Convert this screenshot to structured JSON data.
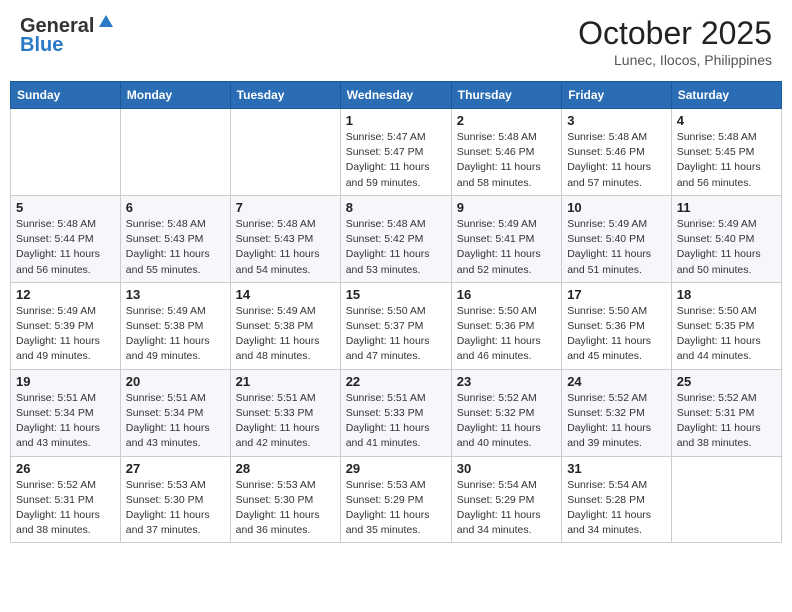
{
  "header": {
    "logo_general": "General",
    "logo_blue": "Blue",
    "month_title": "October 2025",
    "location": "Lunec, Ilocos, Philippines"
  },
  "days_of_week": [
    "Sunday",
    "Monday",
    "Tuesday",
    "Wednesday",
    "Thursday",
    "Friday",
    "Saturday"
  ],
  "weeks": [
    {
      "cells": [
        {
          "day": "",
          "content": ""
        },
        {
          "day": "",
          "content": ""
        },
        {
          "day": "",
          "content": ""
        },
        {
          "day": "1",
          "content": "Sunrise: 5:47 AM\nSunset: 5:47 PM\nDaylight: 11 hours\nand 59 minutes."
        },
        {
          "day": "2",
          "content": "Sunrise: 5:48 AM\nSunset: 5:46 PM\nDaylight: 11 hours\nand 58 minutes."
        },
        {
          "day": "3",
          "content": "Sunrise: 5:48 AM\nSunset: 5:46 PM\nDaylight: 11 hours\nand 57 minutes."
        },
        {
          "day": "4",
          "content": "Sunrise: 5:48 AM\nSunset: 5:45 PM\nDaylight: 11 hours\nand 56 minutes."
        }
      ]
    },
    {
      "cells": [
        {
          "day": "5",
          "content": "Sunrise: 5:48 AM\nSunset: 5:44 PM\nDaylight: 11 hours\nand 56 minutes."
        },
        {
          "day": "6",
          "content": "Sunrise: 5:48 AM\nSunset: 5:43 PM\nDaylight: 11 hours\nand 55 minutes."
        },
        {
          "day": "7",
          "content": "Sunrise: 5:48 AM\nSunset: 5:43 PM\nDaylight: 11 hours\nand 54 minutes."
        },
        {
          "day": "8",
          "content": "Sunrise: 5:48 AM\nSunset: 5:42 PM\nDaylight: 11 hours\nand 53 minutes."
        },
        {
          "day": "9",
          "content": "Sunrise: 5:49 AM\nSunset: 5:41 PM\nDaylight: 11 hours\nand 52 minutes."
        },
        {
          "day": "10",
          "content": "Sunrise: 5:49 AM\nSunset: 5:40 PM\nDaylight: 11 hours\nand 51 minutes."
        },
        {
          "day": "11",
          "content": "Sunrise: 5:49 AM\nSunset: 5:40 PM\nDaylight: 11 hours\nand 50 minutes."
        }
      ]
    },
    {
      "cells": [
        {
          "day": "12",
          "content": "Sunrise: 5:49 AM\nSunset: 5:39 PM\nDaylight: 11 hours\nand 49 minutes."
        },
        {
          "day": "13",
          "content": "Sunrise: 5:49 AM\nSunset: 5:38 PM\nDaylight: 11 hours\nand 49 minutes."
        },
        {
          "day": "14",
          "content": "Sunrise: 5:49 AM\nSunset: 5:38 PM\nDaylight: 11 hours\nand 48 minutes."
        },
        {
          "day": "15",
          "content": "Sunrise: 5:50 AM\nSunset: 5:37 PM\nDaylight: 11 hours\nand 47 minutes."
        },
        {
          "day": "16",
          "content": "Sunrise: 5:50 AM\nSunset: 5:36 PM\nDaylight: 11 hours\nand 46 minutes."
        },
        {
          "day": "17",
          "content": "Sunrise: 5:50 AM\nSunset: 5:36 PM\nDaylight: 11 hours\nand 45 minutes."
        },
        {
          "day": "18",
          "content": "Sunrise: 5:50 AM\nSunset: 5:35 PM\nDaylight: 11 hours\nand 44 minutes."
        }
      ]
    },
    {
      "cells": [
        {
          "day": "19",
          "content": "Sunrise: 5:51 AM\nSunset: 5:34 PM\nDaylight: 11 hours\nand 43 minutes."
        },
        {
          "day": "20",
          "content": "Sunrise: 5:51 AM\nSunset: 5:34 PM\nDaylight: 11 hours\nand 43 minutes."
        },
        {
          "day": "21",
          "content": "Sunrise: 5:51 AM\nSunset: 5:33 PM\nDaylight: 11 hours\nand 42 minutes."
        },
        {
          "day": "22",
          "content": "Sunrise: 5:51 AM\nSunset: 5:33 PM\nDaylight: 11 hours\nand 41 minutes."
        },
        {
          "day": "23",
          "content": "Sunrise: 5:52 AM\nSunset: 5:32 PM\nDaylight: 11 hours\nand 40 minutes."
        },
        {
          "day": "24",
          "content": "Sunrise: 5:52 AM\nSunset: 5:32 PM\nDaylight: 11 hours\nand 39 minutes."
        },
        {
          "day": "25",
          "content": "Sunrise: 5:52 AM\nSunset: 5:31 PM\nDaylight: 11 hours\nand 38 minutes."
        }
      ]
    },
    {
      "cells": [
        {
          "day": "26",
          "content": "Sunrise: 5:52 AM\nSunset: 5:31 PM\nDaylight: 11 hours\nand 38 minutes."
        },
        {
          "day": "27",
          "content": "Sunrise: 5:53 AM\nSunset: 5:30 PM\nDaylight: 11 hours\nand 37 minutes."
        },
        {
          "day": "28",
          "content": "Sunrise: 5:53 AM\nSunset: 5:30 PM\nDaylight: 11 hours\nand 36 minutes."
        },
        {
          "day": "29",
          "content": "Sunrise: 5:53 AM\nSunset: 5:29 PM\nDaylight: 11 hours\nand 35 minutes."
        },
        {
          "day": "30",
          "content": "Sunrise: 5:54 AM\nSunset: 5:29 PM\nDaylight: 11 hours\nand 34 minutes."
        },
        {
          "day": "31",
          "content": "Sunrise: 5:54 AM\nSunset: 5:28 PM\nDaylight: 11 hours\nand 34 minutes."
        },
        {
          "day": "",
          "content": ""
        }
      ]
    }
  ]
}
